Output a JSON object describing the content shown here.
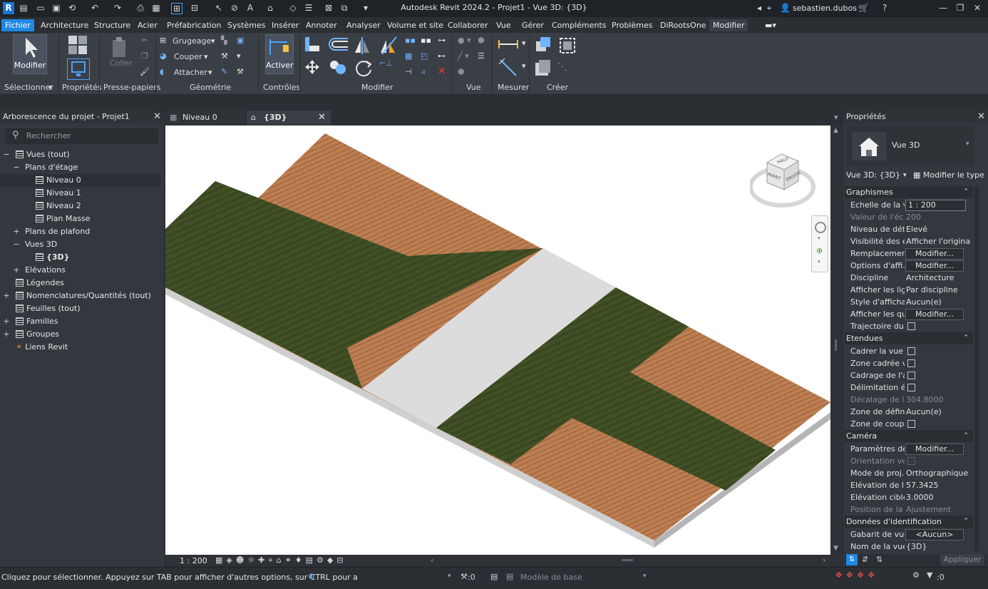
{
  "app": {
    "title": "Autodesk Revit 2024.2 - Projet1 - Vue 3D: {3D}",
    "logo": "R",
    "user": "sebastien.dubos"
  },
  "tabs": [
    "Fichier",
    "Architecture",
    "Structure",
    "Acier",
    "Préfabrication",
    "Systèmes",
    "Insérer",
    "Annoter",
    "Analyser",
    "Volume et site",
    "Collaborer",
    "Vue",
    "Gérer",
    "Compléments",
    "Problèmes",
    "DiRootsOne",
    "Modifier"
  ],
  "ribbon": {
    "modify_label": "Modifier",
    "select_label": "Sélectionner",
    "properties_label": "Propriétés",
    "clipboard_label": "Presse-papiers",
    "paste_label": "Coller",
    "cope_label": "Grugeage",
    "cut_label": "Couper",
    "join_label": "Attacher",
    "geometry_label": "Géométrie",
    "activate_label": "Activer",
    "controls_label": "Contrôles",
    "modify_group_label": "Modifier",
    "view_label": "Vue",
    "measure_label": "Mesurer",
    "create_label": "Créer"
  },
  "project_browser": {
    "title": "Arborescence du projet - Projet1",
    "search_placeholder": "Rechercher",
    "items": [
      {
        "label": "Vues (tout)",
        "toggle": "−"
      },
      {
        "label": "Plans d'étage",
        "toggle": "−"
      },
      {
        "label": "Niveau 0"
      },
      {
        "label": "Niveau 1"
      },
      {
        "label": "Niveau 2"
      },
      {
        "label": "Plan Masse"
      },
      {
        "label": "Plans de plafond",
        "toggle": "+"
      },
      {
        "label": "Vues 3D",
        "toggle": "−"
      },
      {
        "label": "{3D}"
      },
      {
        "label": "Elévations",
        "toggle": "+"
      },
      {
        "label": "Légendes"
      },
      {
        "label": "Nomenclatures/Quantités (tout)",
        "toggle": "+"
      },
      {
        "label": "Feuilles (tout)"
      },
      {
        "label": "Familles",
        "toggle": "+"
      },
      {
        "label": "Groupes",
        "toggle": "+"
      },
      {
        "label": "Liens Revit"
      }
    ]
  },
  "view_tabs": [
    {
      "label": "Niveau 0"
    },
    {
      "label": "{3D}"
    }
  ],
  "viewcube": {
    "top": "HAUT",
    "front": "AVANT",
    "right": "DROITE"
  },
  "view_bar": {
    "scale": "1 : 200"
  },
  "properties": {
    "title": "Propriétés",
    "type_name": "Vue 3D",
    "selector": "Vue 3D: {3D}",
    "edit_type": "Modifier le type",
    "groups": [
      {
        "name": "Graphismes",
        "rows": [
          {
            "k": "Echelle de la v...",
            "v": "1 : 200",
            "kind": "input"
          },
          {
            "k": "Valeur de l'éc...",
            "v": "200",
            "disabled": true
          },
          {
            "k": "Niveau de dét...",
            "v": "Elevé"
          },
          {
            "k": "Visibilité des é...",
            "v": "Afficher l'original"
          },
          {
            "k": "Remplacemen...",
            "v": "Modifier...",
            "kind": "button"
          },
          {
            "k": "Options d'affi...",
            "v": "Modifier...",
            "kind": "button"
          },
          {
            "k": "Discipline",
            "v": "Architecture"
          },
          {
            "k": "Afficher les lig...",
            "v": "Par discipline"
          },
          {
            "k": "Style d'afficha...",
            "v": "Aucun(e)"
          },
          {
            "k": "Afficher les qu...",
            "v": "Modifier...",
            "kind": "button"
          },
          {
            "k": "Trajectoire du ...",
            "v": "",
            "kind": "check"
          }
        ]
      },
      {
        "name": "Etendues",
        "rows": [
          {
            "k": "Cadrer la vue",
            "v": "",
            "kind": "check"
          },
          {
            "k": "Zone cadrée v...",
            "v": "",
            "kind": "check"
          },
          {
            "k": "Cadrage de l'a...",
            "v": "",
            "kind": "check"
          },
          {
            "k": "Délimitation é...",
            "v": "",
            "kind": "check"
          },
          {
            "k": "Décalage de l...",
            "v": "304.8000",
            "disabled": true
          },
          {
            "k": "Zone de défin...",
            "v": "Aucun(e)"
          },
          {
            "k": "Zone de coupe",
            "v": "",
            "kind": "check"
          }
        ]
      },
      {
        "name": "Caméra",
        "rows": [
          {
            "k": "Paramètres de...",
            "v": "Modifier...",
            "kind": "button"
          },
          {
            "k": "Orientation ve...",
            "v": "",
            "kind": "check",
            "disabled": true
          },
          {
            "k": "Mode de proj...",
            "v": "Orthographique"
          },
          {
            "k": "Elévation de l'...",
            "v": "57.3425"
          },
          {
            "k": "Elévation cible",
            "v": "3.0000"
          },
          {
            "k": "Position de la ...",
            "v": "Ajustement",
            "disabled": true
          }
        ]
      },
      {
        "name": "Données d'identification",
        "rows": [
          {
            "k": "Gabarit de vue",
            "v": "<Aucun>",
            "kind": "button"
          },
          {
            "k": "Nom de la vue",
            "v": "{3D}"
          }
        ]
      }
    ],
    "apply": "Appliquer"
  },
  "status": {
    "message": "Cliquez pour sélectionner. Appuyez sur TAB pour afficher d'autres options, sur CTRL pour a",
    "workset_count": ":0",
    "model": "Modèle de base",
    "filter_count": ":0"
  },
  "colors": {
    "accent": "#1e88e5",
    "grass": "#3f4e24",
    "wood": "#b97a4e",
    "path": "#dcdcdc"
  }
}
